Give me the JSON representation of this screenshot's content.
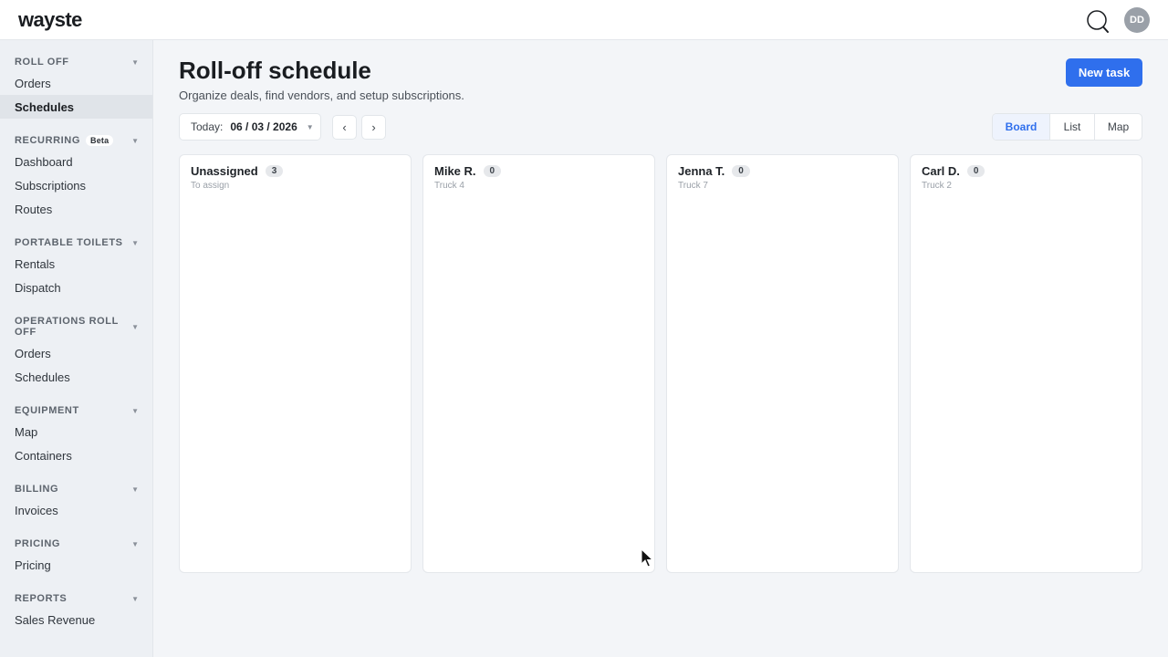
{
  "app": {
    "logo": "wayste",
    "avatar_initials": "DD"
  },
  "icons": {
    "search": "search-icon",
    "cursor": "mouse-pointer-icon",
    "chevron": "chevron-down-icon"
  },
  "colors": {
    "primary": "#2f6fed",
    "active_tab_bg": "#eef3fd",
    "sidebar_bg": "#edf0f4"
  },
  "sidebar": {
    "sections": [
      {
        "title": "ROLL OFF",
        "items": [
          "Orders",
          "Schedules"
        ]
      },
      {
        "title": "RECURRING",
        "badge": "Beta",
        "items": [
          "Dashboard",
          "Subscriptions",
          "Routes"
        ]
      },
      {
        "title": "PORTABLE TOILETS",
        "items": [
          "Rentals",
          "Dispatch"
        ]
      },
      {
        "title": "OPERATIONS ROLL OFF",
        "items": [
          "Orders",
          "Schedules"
        ]
      },
      {
        "title": "EQUIPMENT",
        "items": [
          "Map",
          "Containers"
        ]
      },
      {
        "title": "BILLING",
        "items": [
          "Invoices"
        ]
      },
      {
        "title": "PRICING",
        "items": [
          "Pricing"
        ]
      },
      {
        "title": "REPORTS",
        "items": [
          "Sales Revenue"
        ]
      }
    ],
    "active_item": "Schedules"
  },
  "header": {
    "title": "Roll-off schedule",
    "subtitle": "Organize deals, find vendors, and setup subscriptions.",
    "new_task_label": "New task"
  },
  "toolbar": {
    "date_label": "Today:",
    "date_value": "06 / 03 / 2026",
    "prev_label": "‹",
    "next_label": "›",
    "views": [
      "Board",
      "List",
      "Map"
    ],
    "active_view": "Board"
  },
  "board": {
    "columns": [
      {
        "name": "Unassigned",
        "count": "3",
        "subtitle": "To assign"
      },
      {
        "name": "Mike R.",
        "count": "0",
        "subtitle": "Truck 4"
      },
      {
        "name": "Jenna T.",
        "count": "0",
        "subtitle": "Truck 7"
      },
      {
        "name": "Carl D.",
        "count": "0",
        "subtitle": "Truck 2"
      }
    ]
  }
}
